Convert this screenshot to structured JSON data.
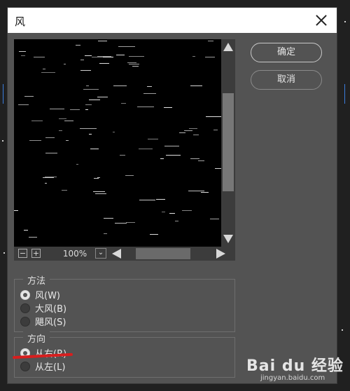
{
  "dialog": {
    "title": "风"
  },
  "preview": {
    "zoom": "100%"
  },
  "buttons": {
    "ok": "确定",
    "cancel": "取消"
  },
  "method": {
    "legend": "方法",
    "options": [
      {
        "label": "风(W)",
        "checked": true
      },
      {
        "label": "大风(B)",
        "checked": false
      },
      {
        "label": "飓风(S)",
        "checked": false
      }
    ]
  },
  "direction": {
    "legend": "方向",
    "options": [
      {
        "label": "从右(R)",
        "checked": true
      },
      {
        "label": "从左(L)",
        "checked": false
      }
    ]
  },
  "watermark": {
    "text": "Bai du 经验",
    "sub": "jingyan.baidu.com"
  },
  "colors": {
    "dialog_bg": "#535353",
    "annotation": "#d81e1e",
    "preview_bg": "#000000"
  }
}
